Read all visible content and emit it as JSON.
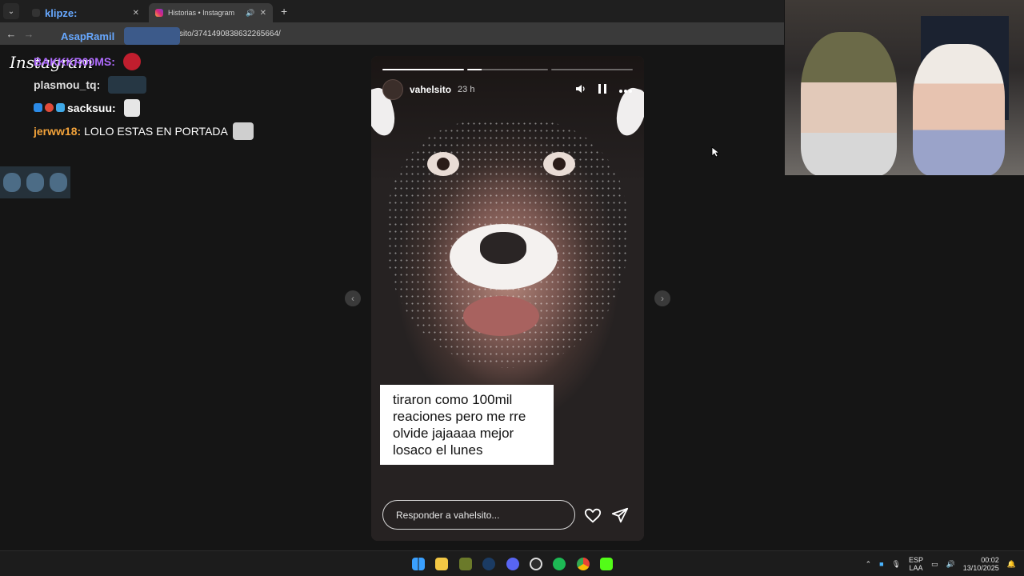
{
  "browser": {
    "tabs": [
      {
        "label": "klipze:",
        "active": false
      },
      {
        "label": "Historias • Instagram",
        "active": true
      }
    ],
    "url": "sito/3741490838632265664/"
  },
  "overlay": {
    "logo": "Instagram",
    "top_username": "AsapRamil",
    "chat": [
      {
        "user": "BAKKKR00MS:",
        "user_color": "#b06cff",
        "message": ""
      },
      {
        "user": "plasmou_tq:",
        "user_color": "#dcdcdc",
        "message": ""
      },
      {
        "user": "sacksuu:",
        "user_color": "#ffffff",
        "message": ""
      },
      {
        "user": "jerww18:",
        "user_color": "#f2a23a",
        "message": "LOLO ESTAS EN PORTADA"
      }
    ]
  },
  "story": {
    "username": "vahelsito",
    "time": "23 h",
    "caption": "tiraron como 100mil reaciones pero me rre olvide jajaaaa mejor losaco el lunes",
    "reply_placeholder": "Responder a vahelsito...",
    "progress_segments": 3,
    "progress_current": 2
  },
  "taskbar": {
    "lang_top": "ESP",
    "lang_bottom": "LAA",
    "time": "00:02",
    "date": "13/10/2025"
  },
  "colors": {
    "accent_blue": "#67a8ff",
    "story_caption_bg": "#ffffff"
  }
}
